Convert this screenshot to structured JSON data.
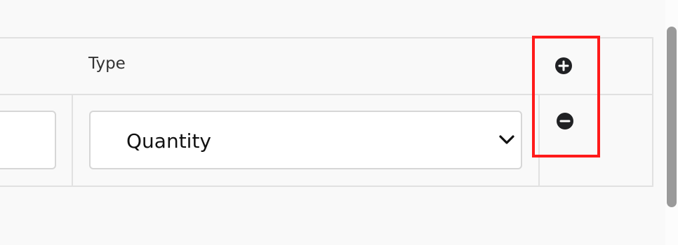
{
  "table": {
    "type_header": "Type"
  },
  "row": {
    "type_select": {
      "value": "Quantity"
    }
  },
  "actions": {
    "add_icon": "plus-circle-icon",
    "remove_icon": "minus-circle-icon"
  },
  "colors": {
    "background": "#f9f9f9",
    "table_border": "#e1e1e1",
    "input_border": "#d6d6d6",
    "highlight": "#ff1a1a",
    "icon": "#202124",
    "scrollbar_thumb": "#9a9a9a"
  }
}
